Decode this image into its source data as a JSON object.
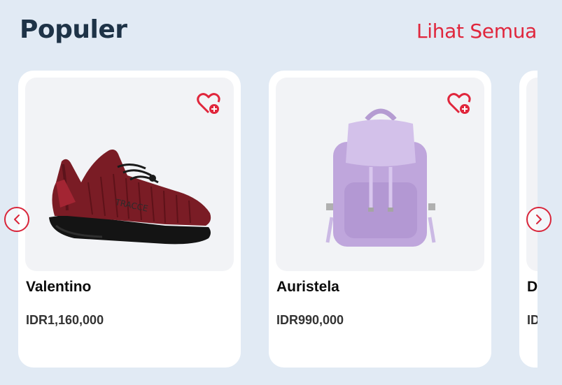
{
  "section": {
    "title": "Populer",
    "see_all": "Lihat Semua"
  },
  "products": [
    {
      "name": "Valentino",
      "price": "IDR1,160,000",
      "image": "sneaker-red",
      "wishlist_icon": "heart-plus-icon"
    },
    {
      "name": "Auristela",
      "price": "IDR990,000",
      "image": "backpack-lilac",
      "wishlist_icon": "heart-plus-icon"
    },
    {
      "name": "D",
      "price": "ID",
      "image": "partial-card"
    }
  ],
  "nav": {
    "prev_icon": "chevron-left-icon",
    "next_icon": "chevron-right-icon"
  },
  "colors": {
    "accent": "#e0263c",
    "title": "#1e3347",
    "background": "#e1eaf4"
  }
}
